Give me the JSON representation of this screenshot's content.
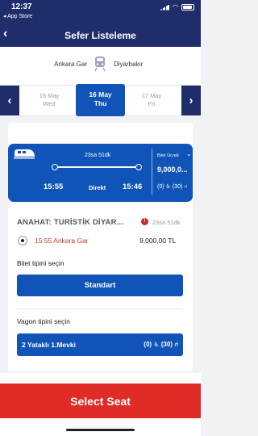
{
  "status_bar": {
    "time": "12:37",
    "back_app": "◂ App Store"
  },
  "header": {
    "back_icon": "chevron-left-icon",
    "title": "Sefer Listeleme"
  },
  "route": {
    "from": "Ankara Gar",
    "to": "Diyarbakır",
    "icon": "train-icon"
  },
  "dates": {
    "prev": {
      "day": "15 May",
      "weekday": "Wed"
    },
    "current": {
      "day": "16 May",
      "weekday": "Thu"
    },
    "next": {
      "day": "17 May",
      "weekday": "Fri"
    }
  },
  "trip": {
    "duration": "23sa 51dk",
    "departure": "15:55",
    "type": "Direkt",
    "arrival": "15:46",
    "fee_label": "Bilet Ücreti",
    "price": "9,000,0...",
    "wheelchair_count": "(0)",
    "seat_count": "(30)"
  },
  "details": {
    "train_name": "ANAHAT: TURİSTİK DİYAR...",
    "duration": "23sa 51dk",
    "departure_station": "15:55 Ankara Gar",
    "price": "9,000,00 TL",
    "ticket_type_label": "Bilet tipini seçin",
    "ticket_type": "Standart",
    "wagon_type_label": "Vagon tipini seçin",
    "wagon_name": "2 Yataklı 1.Mevki",
    "wagon_wheelchair": "(0)",
    "wagon_seats": "(30)"
  },
  "footer": {
    "select_label": "Select Seat"
  },
  "colors": {
    "header": "#1f2d6a",
    "primary": "#1054b8",
    "cta": "#e02b27",
    "station": "#c0392b"
  }
}
